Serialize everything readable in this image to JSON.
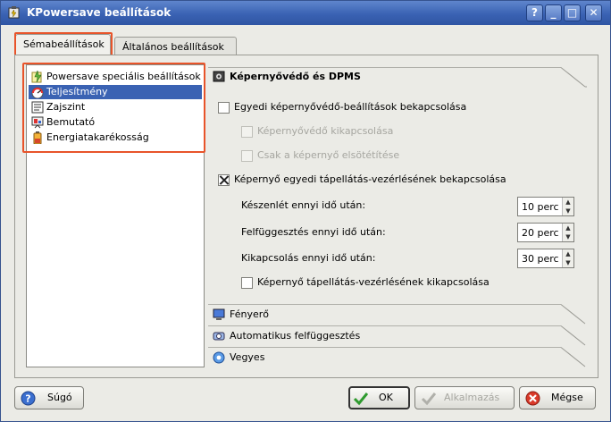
{
  "window": {
    "title": "KPowersave beállítások",
    "controls": [
      "?",
      "_",
      "□",
      "✕"
    ]
  },
  "tabs": [
    {
      "label": "Sémabeállítások"
    },
    {
      "label": "Általános beállítások"
    }
  ],
  "schemes": [
    {
      "label": "Powersave speciális beállítások",
      "icon": "powersave-icon"
    },
    {
      "label": "Teljesítmény",
      "icon": "performance-icon",
      "selected": true
    },
    {
      "label": "Zajszint",
      "icon": "acoustic-icon"
    },
    {
      "label": "Bemutató",
      "icon": "presentation-icon"
    },
    {
      "label": "Energiatakarékosság",
      "icon": "battery-icon"
    }
  ],
  "sections": {
    "screensaver": {
      "title": "Képernyővédő és DPMS",
      "enable_screensaver": {
        "label": "Egyedi képernyővédő-beállítások bekapcsolása",
        "checked": false
      },
      "disable_screensaver": {
        "label": "Képernyővédő kikapcsolása",
        "checked": false,
        "disabled": true
      },
      "blank_only": {
        "label": "Csak a képernyő elsötétítése",
        "checked": false,
        "disabled": true
      },
      "enable_dpms": {
        "label": "Képernyő egyedi tápellátás-vezérlésének bekapcsolása",
        "checked": true
      },
      "standby": {
        "label": "Készenlét ennyi idő után:",
        "value": "10 perc"
      },
      "suspend": {
        "label": "Felfüggesztés ennyi idő után:",
        "value": "20 perc"
      },
      "off": {
        "label": "Kikapcsolás ennyi idő után:",
        "value": "30 perc"
      },
      "disable_dpms": {
        "label": "Képernyő tápellátás-vezérlésének kikapcsolása",
        "checked": false
      }
    },
    "brightness": {
      "title": "Fényerő"
    },
    "autosuspend": {
      "title": "Automatikus felfüggesztés"
    },
    "misc": {
      "title": "Vegyes"
    }
  },
  "buttons": {
    "help": "Súgó",
    "ok": "OK",
    "apply": "Alkalmazás",
    "cancel": "Mégse"
  },
  "colors": {
    "titlebar": "#3a62b3",
    "selection": "#3a62b3",
    "highlight": "#e8542a"
  }
}
